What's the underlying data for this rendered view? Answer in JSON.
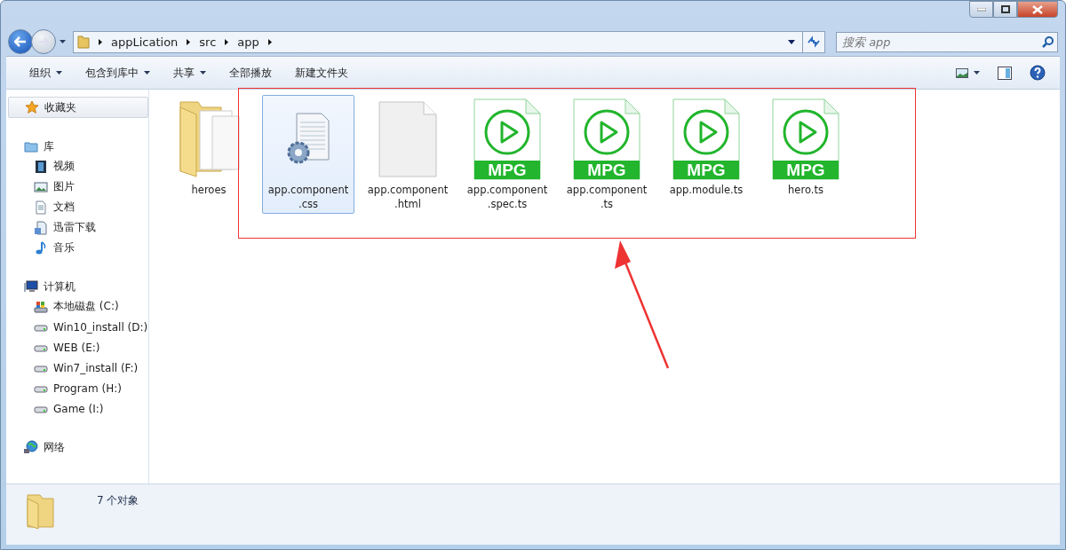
{
  "address_bar": {
    "path": [
      "appLication",
      "src",
      "app"
    ]
  },
  "search": {
    "placeholder": "搜索 app"
  },
  "toolbar": {
    "buttons": [
      {
        "label": "组织",
        "dropdown": true
      },
      {
        "label": "包含到库中",
        "dropdown": true
      },
      {
        "label": "共享",
        "dropdown": true
      },
      {
        "label": "全部播放",
        "dropdown": false
      },
      {
        "label": "新建文件夹",
        "dropdown": false
      }
    ]
  },
  "sidebar": {
    "groups": [
      {
        "label": "收藏夹",
        "kind": "favorites",
        "selected": true
      },
      {
        "label": "库",
        "kind": "library",
        "selected": false,
        "items": [
          {
            "label": "视频",
            "kind": "video"
          },
          {
            "label": "图片",
            "kind": "picture"
          },
          {
            "label": "文档",
            "kind": "document"
          },
          {
            "label": "迅雷下载",
            "kind": "download"
          },
          {
            "label": "音乐",
            "kind": "music"
          }
        ]
      },
      {
        "label": "计算机",
        "kind": "computer",
        "selected": false,
        "items": [
          {
            "label": "本地磁盘 (C:)",
            "kind": "system-drive"
          },
          {
            "label": "Win10_install (D:)",
            "kind": "drive"
          },
          {
            "label": "WEB (E:)",
            "kind": "drive"
          },
          {
            "label": "Win7_install (F:)",
            "kind": "drive"
          },
          {
            "label": "Program (H:)",
            "kind": "drive"
          },
          {
            "label": "Game (I:)",
            "kind": "drive"
          }
        ]
      },
      {
        "label": "网络",
        "kind": "network",
        "selected": false
      }
    ]
  },
  "files": [
    {
      "name": "heroes",
      "kind": "folder",
      "selected": false
    },
    {
      "name": "app.component\n.css",
      "kind": "config",
      "selected": true
    },
    {
      "name": "app.component\n.html",
      "kind": "blank",
      "selected": false
    },
    {
      "name": "app.component\n.spec.ts",
      "kind": "video",
      "badge": "MPG",
      "selected": false
    },
    {
      "name": "app.component\n.ts",
      "kind": "video",
      "badge": "MPG",
      "selected": false
    },
    {
      "name": "app.module.ts",
      "kind": "video",
      "badge": "MPG",
      "selected": false
    },
    {
      "name": "hero.ts",
      "kind": "video",
      "badge": "MPG",
      "selected": false
    }
  ],
  "status_bar": {
    "text": "7 个对象"
  }
}
